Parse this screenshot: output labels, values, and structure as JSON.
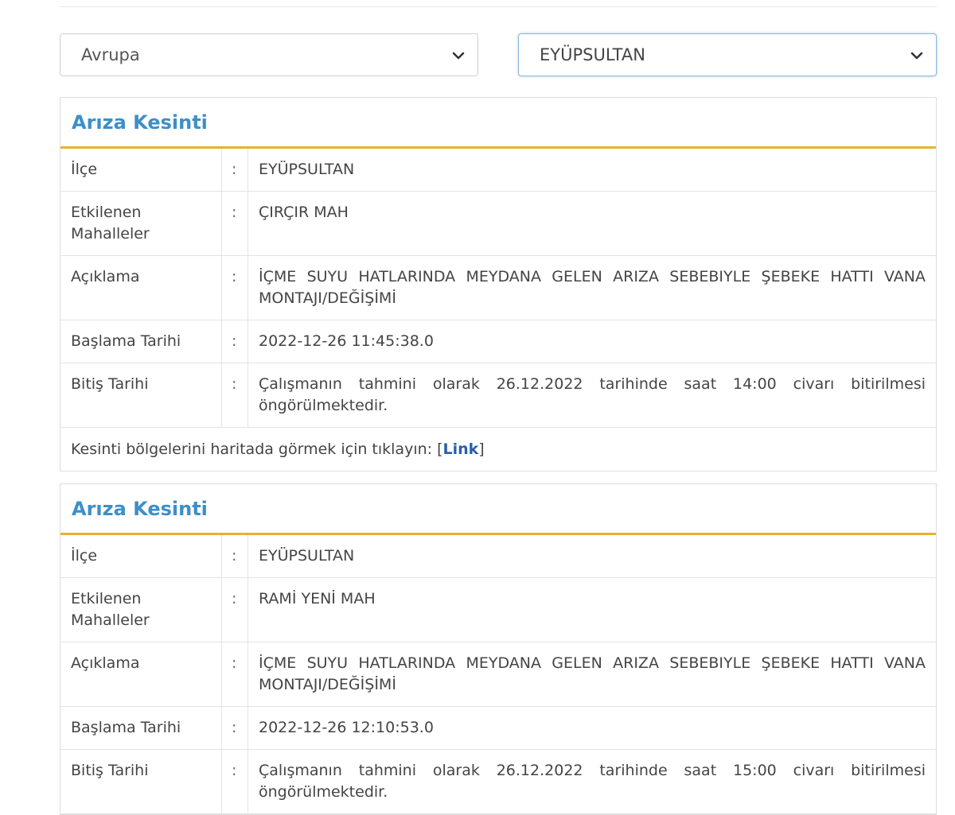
{
  "filters": {
    "region": "Avrupa",
    "district": "EYÜPSULTAN"
  },
  "labels": {
    "district": "İlçe",
    "affected": "Etkilenen Mahalleler",
    "description": "Açıklama",
    "start": "Başlama Tarihi",
    "end": "Bitiş Tarihi",
    "colon": ":"
  },
  "outages": [
    {
      "title": "Arıza Kesinti",
      "district": "EYÜPSULTAN",
      "affected": "ÇIRÇIR MAH",
      "description": "İÇME SUYU HATLARINDA MEYDANA GELEN ARIZA SEBEBIYLE ŞEBEKE HATTI VANA MONTAJI/DEĞİŞİMİ",
      "start": "2022-12-26 11:45:38.0",
      "end": "Çalışmanın tahmini olarak 26.12.2022 tarihinde saat 14:00 civarı bitirilmesi öngörülmektedir.",
      "map_prefix": "Kesinti bölgelerini haritada görmek için tıklayın: [",
      "map_link": "Link",
      "map_suffix": "]"
    },
    {
      "title": "Arıza Kesinti",
      "district": "EYÜPSULTAN",
      "affected": "RAMİ YENİ MAH",
      "description": "İÇME SUYU HATLARINDA MEYDANA GELEN ARIZA SEBEBIYLE ŞEBEKE HATTI VANA MONTAJI/DEĞİŞİMİ",
      "start": "2022-12-26 12:10:53.0",
      "end": "Çalışmanın tahmini olarak 26.12.2022 tarihinde saat 15:00 civarı bitirilmesi öngörülmektedir."
    }
  ]
}
